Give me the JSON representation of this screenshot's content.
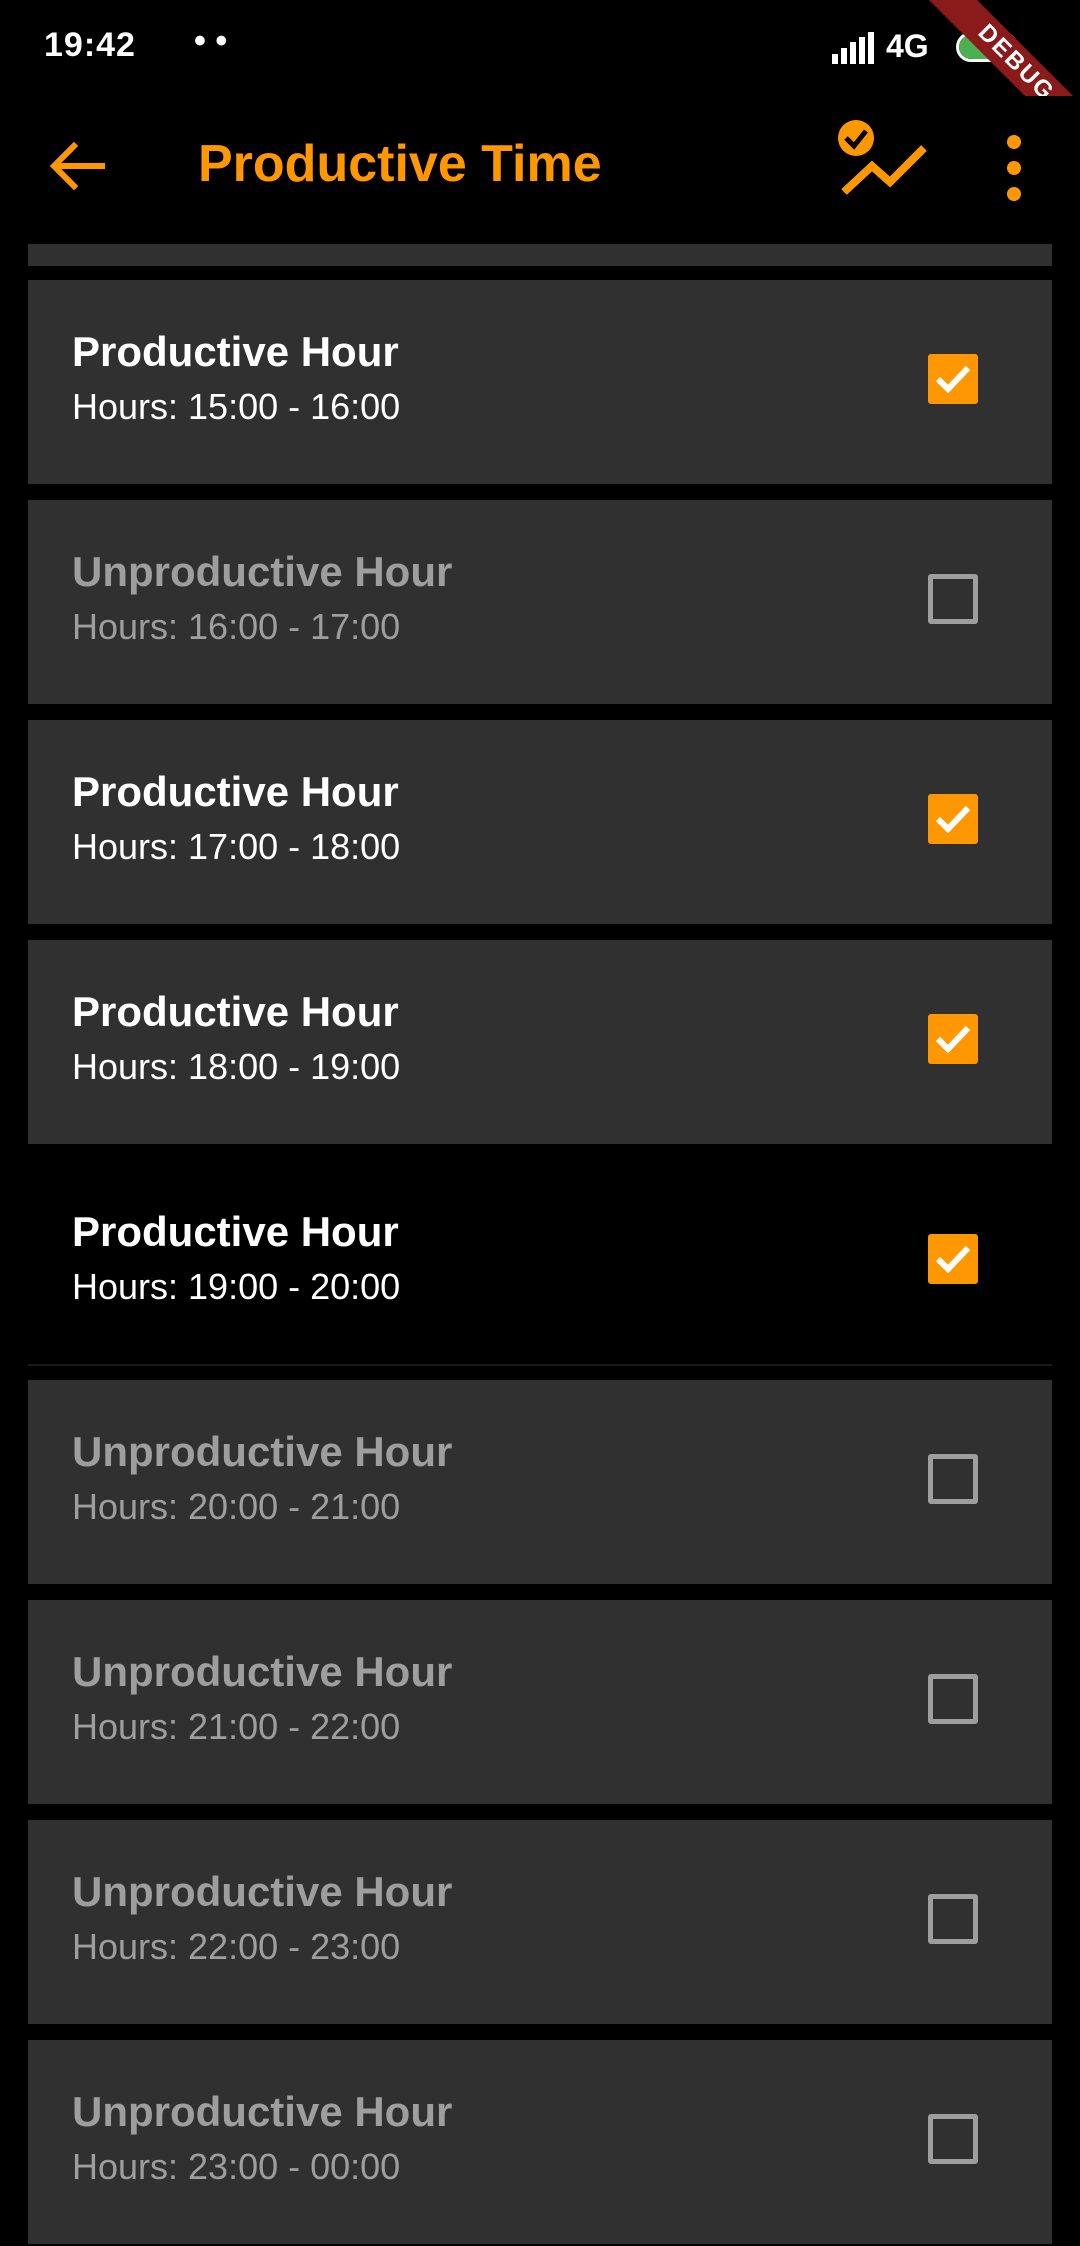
{
  "status_bar": {
    "time": "19:42",
    "dots": "• •",
    "network": "4G",
    "battery_percent": "53",
    "battery_level": 0.53,
    "debug_banner": "DEBUG"
  },
  "app_bar": {
    "title": "Productive Time",
    "icons": [
      "arrow-back-icon",
      "productivity-chart-icon",
      "more-vert-icon"
    ]
  },
  "colors": {
    "accent": "#FF9800",
    "card_bg": "#303030",
    "muted_text": "#9e9e9e",
    "battery": "#4CAF50",
    "debug_ribbon": "#8B1A1A"
  },
  "hours": [
    {
      "title": "Productive Hour",
      "range": "Hours: 15:00 - 16:00",
      "checked": true
    },
    {
      "title": "Unproductive Hour",
      "range": "Hours: 16:00 - 17:00",
      "checked": false
    },
    {
      "title": "Productive Hour",
      "range": "Hours: 17:00 - 18:00",
      "checked": true
    },
    {
      "title": "Productive Hour",
      "range": "Hours: 18:00 - 19:00",
      "checked": true
    },
    {
      "title": "Productive Hour",
      "range": "Hours: 19:00 - 20:00",
      "checked": true,
      "current": true
    },
    {
      "title": "Unproductive Hour",
      "range": "Hours: 20:00 - 21:00",
      "checked": false
    },
    {
      "title": "Unproductive Hour",
      "range": "Hours: 21:00 - 22:00",
      "checked": false
    },
    {
      "title": "Unproductive Hour",
      "range": "Hours: 22:00 - 23:00",
      "checked": false
    },
    {
      "title": "Unproductive Hour",
      "range": "Hours: 23:00 - 00:00",
      "checked": false
    }
  ]
}
